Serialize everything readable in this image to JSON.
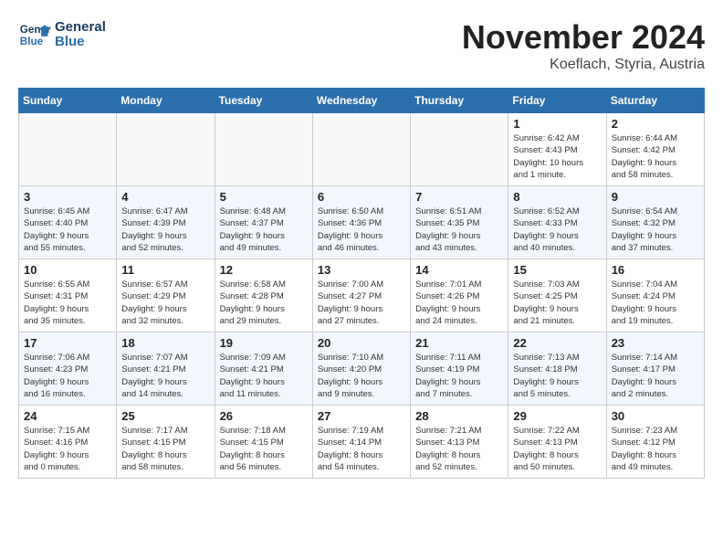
{
  "header": {
    "logo_line1": "General",
    "logo_line2": "Blue",
    "month": "November 2024",
    "location": "Koeflach, Styria, Austria"
  },
  "weekdays": [
    "Sunday",
    "Monday",
    "Tuesday",
    "Wednesday",
    "Thursday",
    "Friday",
    "Saturday"
  ],
  "weeks": [
    [
      {
        "day": "",
        "info": ""
      },
      {
        "day": "",
        "info": ""
      },
      {
        "day": "",
        "info": ""
      },
      {
        "day": "",
        "info": ""
      },
      {
        "day": "",
        "info": ""
      },
      {
        "day": "1",
        "info": "Sunrise: 6:42 AM\nSunset: 4:43 PM\nDaylight: 10 hours\nand 1 minute."
      },
      {
        "day": "2",
        "info": "Sunrise: 6:44 AM\nSunset: 4:42 PM\nDaylight: 9 hours\nand 58 minutes."
      }
    ],
    [
      {
        "day": "3",
        "info": "Sunrise: 6:45 AM\nSunset: 4:40 PM\nDaylight: 9 hours\nand 55 minutes."
      },
      {
        "day": "4",
        "info": "Sunrise: 6:47 AM\nSunset: 4:39 PM\nDaylight: 9 hours\nand 52 minutes."
      },
      {
        "day": "5",
        "info": "Sunrise: 6:48 AM\nSunset: 4:37 PM\nDaylight: 9 hours\nand 49 minutes."
      },
      {
        "day": "6",
        "info": "Sunrise: 6:50 AM\nSunset: 4:36 PM\nDaylight: 9 hours\nand 46 minutes."
      },
      {
        "day": "7",
        "info": "Sunrise: 6:51 AM\nSunset: 4:35 PM\nDaylight: 9 hours\nand 43 minutes."
      },
      {
        "day": "8",
        "info": "Sunrise: 6:52 AM\nSunset: 4:33 PM\nDaylight: 9 hours\nand 40 minutes."
      },
      {
        "day": "9",
        "info": "Sunrise: 6:54 AM\nSunset: 4:32 PM\nDaylight: 9 hours\nand 37 minutes."
      }
    ],
    [
      {
        "day": "10",
        "info": "Sunrise: 6:55 AM\nSunset: 4:31 PM\nDaylight: 9 hours\nand 35 minutes."
      },
      {
        "day": "11",
        "info": "Sunrise: 6:57 AM\nSunset: 4:29 PM\nDaylight: 9 hours\nand 32 minutes."
      },
      {
        "day": "12",
        "info": "Sunrise: 6:58 AM\nSunset: 4:28 PM\nDaylight: 9 hours\nand 29 minutes."
      },
      {
        "day": "13",
        "info": "Sunrise: 7:00 AM\nSunset: 4:27 PM\nDaylight: 9 hours\nand 27 minutes."
      },
      {
        "day": "14",
        "info": "Sunrise: 7:01 AM\nSunset: 4:26 PM\nDaylight: 9 hours\nand 24 minutes."
      },
      {
        "day": "15",
        "info": "Sunrise: 7:03 AM\nSunset: 4:25 PM\nDaylight: 9 hours\nand 21 minutes."
      },
      {
        "day": "16",
        "info": "Sunrise: 7:04 AM\nSunset: 4:24 PM\nDaylight: 9 hours\nand 19 minutes."
      }
    ],
    [
      {
        "day": "17",
        "info": "Sunrise: 7:06 AM\nSunset: 4:23 PM\nDaylight: 9 hours\nand 16 minutes."
      },
      {
        "day": "18",
        "info": "Sunrise: 7:07 AM\nSunset: 4:21 PM\nDaylight: 9 hours\nand 14 minutes."
      },
      {
        "day": "19",
        "info": "Sunrise: 7:09 AM\nSunset: 4:21 PM\nDaylight: 9 hours\nand 11 minutes."
      },
      {
        "day": "20",
        "info": "Sunrise: 7:10 AM\nSunset: 4:20 PM\nDaylight: 9 hours\nand 9 minutes."
      },
      {
        "day": "21",
        "info": "Sunrise: 7:11 AM\nSunset: 4:19 PM\nDaylight: 9 hours\nand 7 minutes."
      },
      {
        "day": "22",
        "info": "Sunrise: 7:13 AM\nSunset: 4:18 PM\nDaylight: 9 hours\nand 5 minutes."
      },
      {
        "day": "23",
        "info": "Sunrise: 7:14 AM\nSunset: 4:17 PM\nDaylight: 9 hours\nand 2 minutes."
      }
    ],
    [
      {
        "day": "24",
        "info": "Sunrise: 7:15 AM\nSunset: 4:16 PM\nDaylight: 9 hours\nand 0 minutes."
      },
      {
        "day": "25",
        "info": "Sunrise: 7:17 AM\nSunset: 4:15 PM\nDaylight: 8 hours\nand 58 minutes."
      },
      {
        "day": "26",
        "info": "Sunrise: 7:18 AM\nSunset: 4:15 PM\nDaylight: 8 hours\nand 56 minutes."
      },
      {
        "day": "27",
        "info": "Sunrise: 7:19 AM\nSunset: 4:14 PM\nDaylight: 8 hours\nand 54 minutes."
      },
      {
        "day": "28",
        "info": "Sunrise: 7:21 AM\nSunset: 4:13 PM\nDaylight: 8 hours\nand 52 minutes."
      },
      {
        "day": "29",
        "info": "Sunrise: 7:22 AM\nSunset: 4:13 PM\nDaylight: 8 hours\nand 50 minutes."
      },
      {
        "day": "30",
        "info": "Sunrise: 7:23 AM\nSunset: 4:12 PM\nDaylight: 8 hours\nand 49 minutes."
      }
    ]
  ]
}
